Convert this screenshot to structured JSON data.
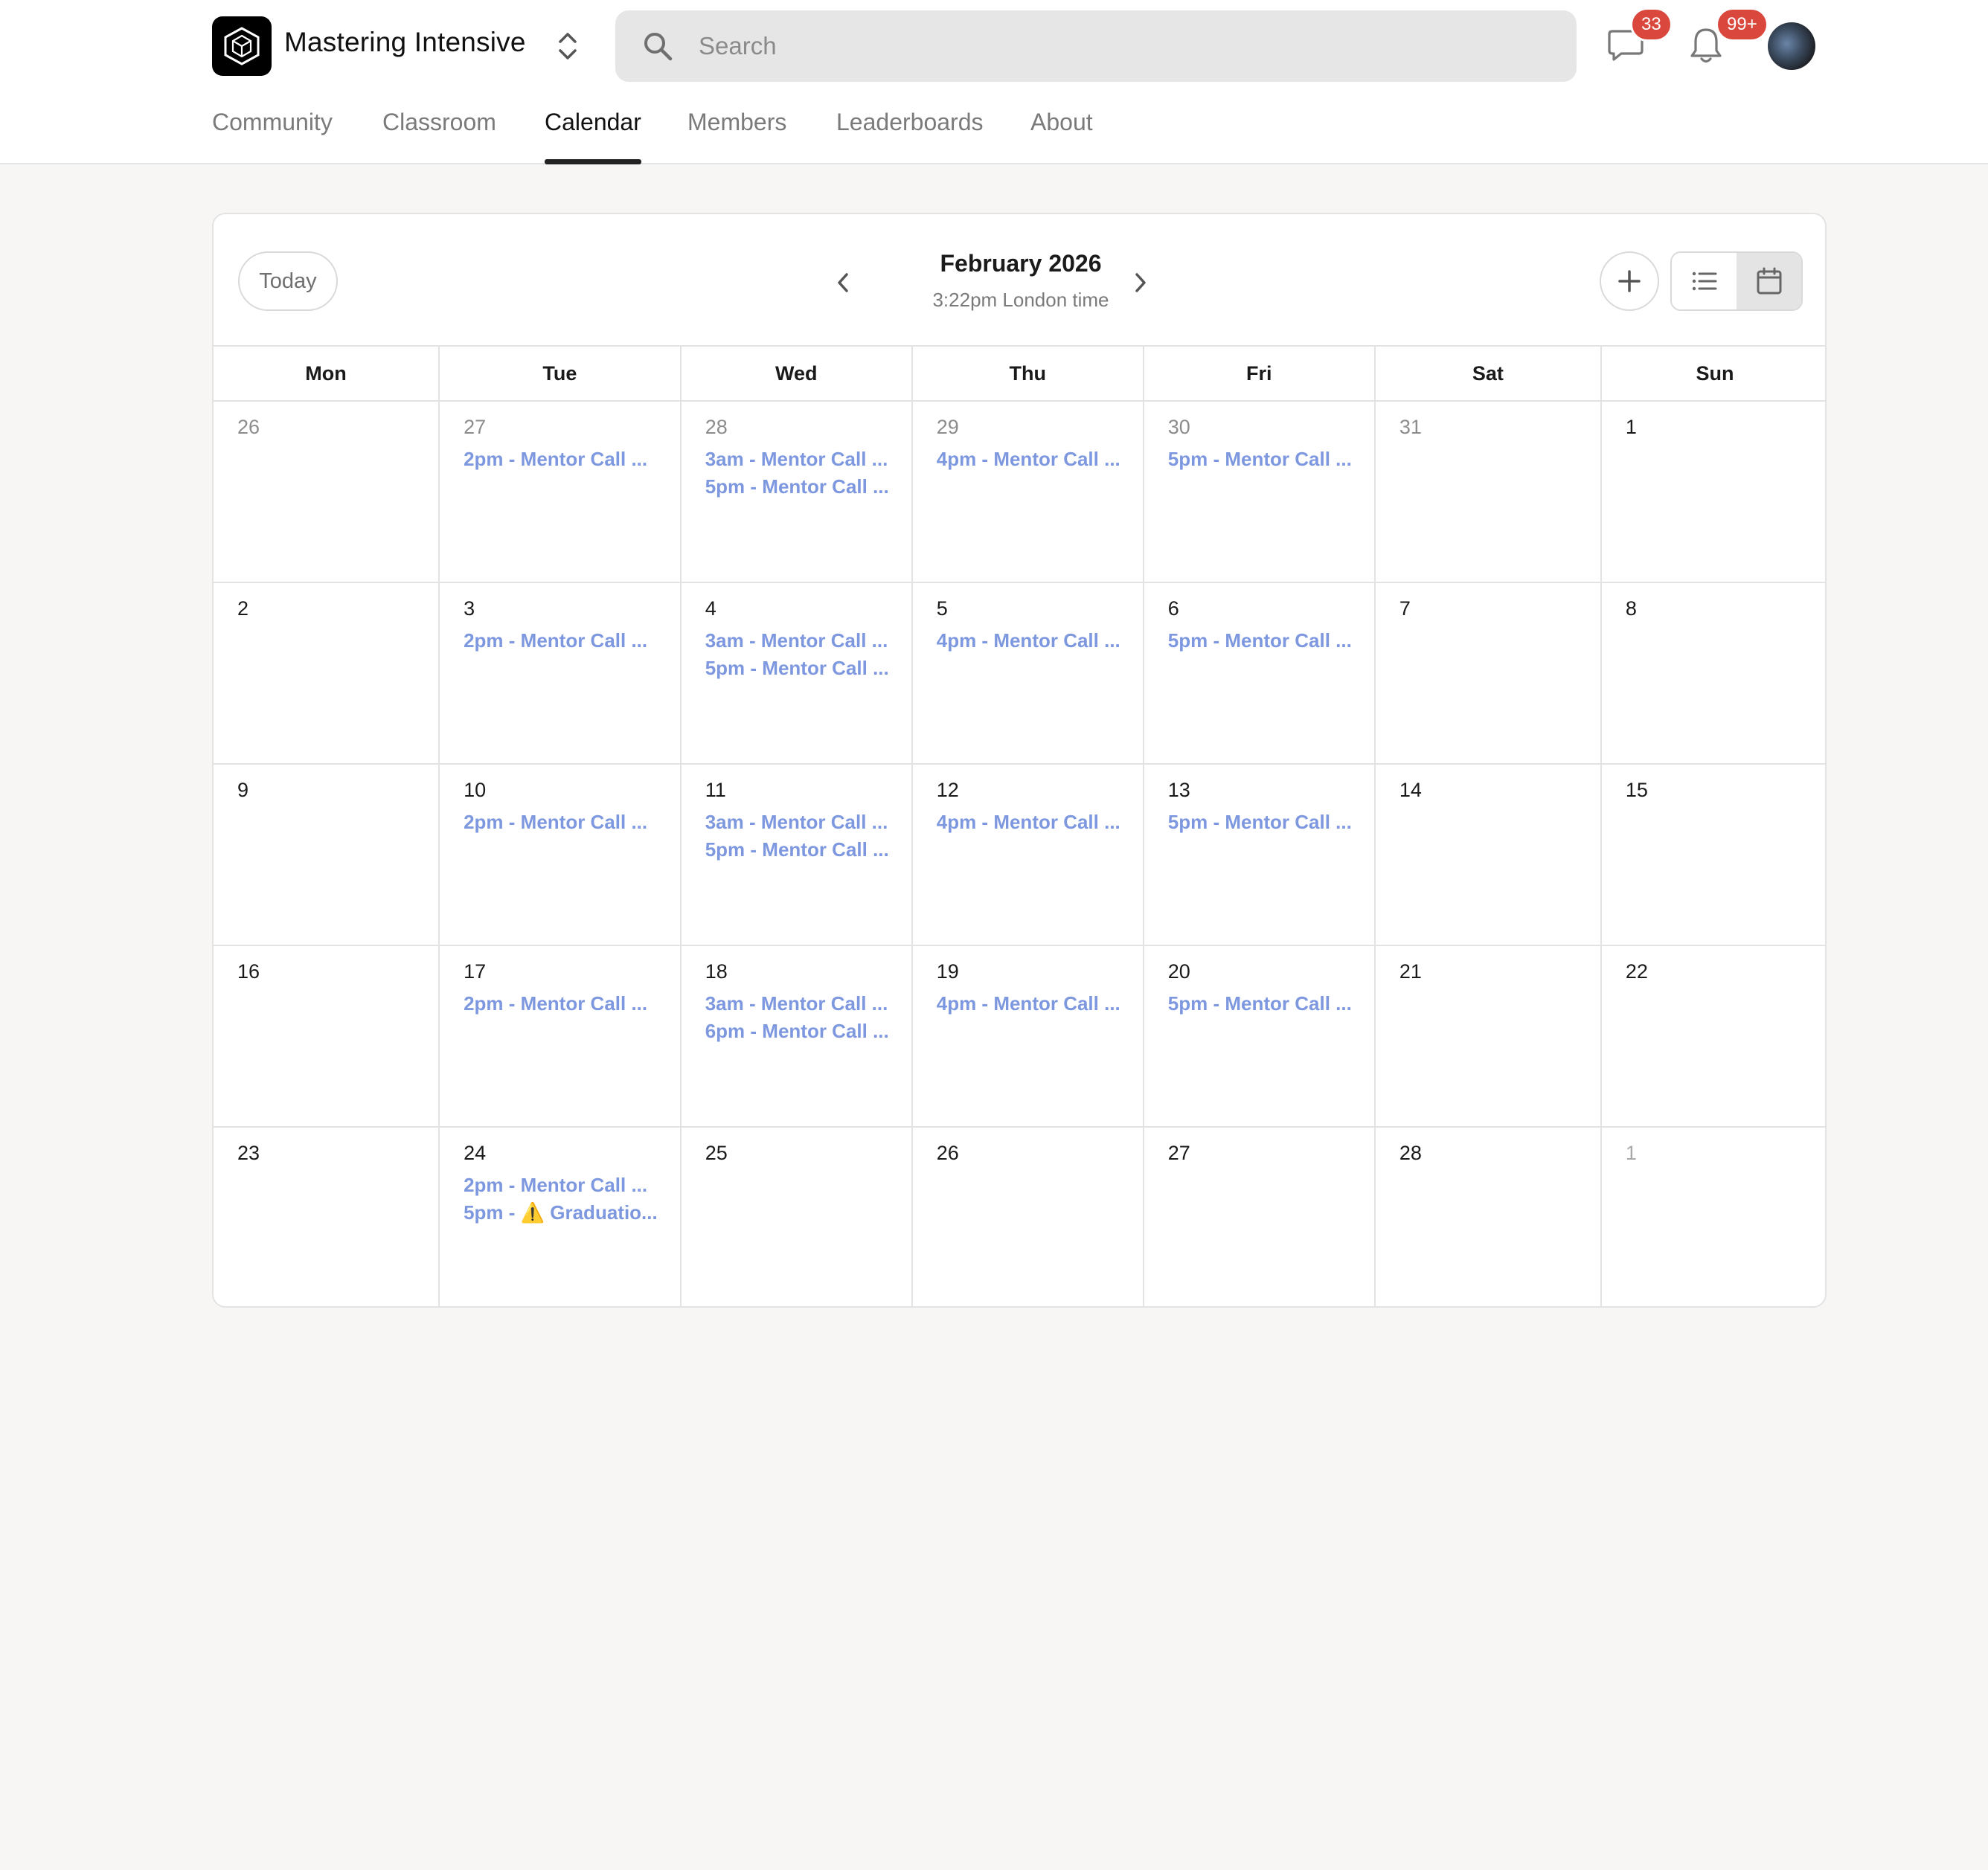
{
  "header": {
    "group_name": "Mastering Intensive",
    "search_placeholder": "Search",
    "chat_badge": "33",
    "notification_badge": "99+",
    "logo_icon": "cube-logo-icon",
    "switcher_icon": "chevron-up-down-icon"
  },
  "nav": {
    "tabs": [
      {
        "label": "Community",
        "active": false
      },
      {
        "label": "Classroom",
        "active": false
      },
      {
        "label": "Calendar",
        "active": true
      },
      {
        "label": "Members",
        "active": false
      },
      {
        "label": "Leaderboards",
        "active": false
      },
      {
        "label": "About",
        "active": false
      }
    ]
  },
  "calendar": {
    "today_label": "Today",
    "month_title": "February 2026",
    "time_subtitle": "3:22pm London time",
    "view_mode": "calendar",
    "weekdays": [
      "Mon",
      "Tue",
      "Wed",
      "Thu",
      "Fri",
      "Sat",
      "Sun"
    ],
    "weeks": [
      [
        {
          "day": "26",
          "muted": true,
          "events": []
        },
        {
          "day": "27",
          "muted": true,
          "events": [
            "2pm - Mentor Call ..."
          ]
        },
        {
          "day": "28",
          "muted": true,
          "events": [
            "3am - Mentor Call ...",
            "5pm - Mentor Call ..."
          ]
        },
        {
          "day": "29",
          "muted": true,
          "events": [
            "4pm - Mentor Call ..."
          ]
        },
        {
          "day": "30",
          "muted": true,
          "events": [
            "5pm - Mentor Call ..."
          ]
        },
        {
          "day": "31",
          "muted": true,
          "events": []
        },
        {
          "day": "1",
          "muted": false,
          "events": []
        }
      ],
      [
        {
          "day": "2",
          "muted": false,
          "events": []
        },
        {
          "day": "3",
          "muted": false,
          "events": [
            "2pm - Mentor Call ..."
          ]
        },
        {
          "day": "4",
          "muted": false,
          "events": [
            "3am - Mentor Call ...",
            "5pm - Mentor Call ..."
          ]
        },
        {
          "day": "5",
          "muted": false,
          "events": [
            "4pm - Mentor Call ..."
          ]
        },
        {
          "day": "6",
          "muted": false,
          "events": [
            "5pm - Mentor Call ..."
          ]
        },
        {
          "day": "7",
          "muted": false,
          "events": []
        },
        {
          "day": "8",
          "muted": false,
          "events": []
        }
      ],
      [
        {
          "day": "9",
          "muted": false,
          "events": []
        },
        {
          "day": "10",
          "muted": false,
          "events": [
            "2pm - Mentor Call ..."
          ]
        },
        {
          "day": "11",
          "muted": false,
          "events": [
            "3am - Mentor Call ...",
            "5pm - Mentor Call ..."
          ]
        },
        {
          "day": "12",
          "muted": false,
          "events": [
            "4pm - Mentor Call ..."
          ]
        },
        {
          "day": "13",
          "muted": false,
          "events": [
            "5pm - Mentor Call ..."
          ]
        },
        {
          "day": "14",
          "muted": false,
          "events": []
        },
        {
          "day": "15",
          "muted": false,
          "events": []
        }
      ],
      [
        {
          "day": "16",
          "muted": false,
          "events": []
        },
        {
          "day": "17",
          "muted": false,
          "events": [
            "2pm - Mentor Call ..."
          ]
        },
        {
          "day": "18",
          "muted": false,
          "events": [
            "3am - Mentor Call ...",
            "6pm - Mentor Call ..."
          ]
        },
        {
          "day": "19",
          "muted": false,
          "events": [
            "4pm - Mentor Call ..."
          ]
        },
        {
          "day": "20",
          "muted": false,
          "events": [
            "5pm - Mentor Call ..."
          ]
        },
        {
          "day": "21",
          "muted": false,
          "events": []
        },
        {
          "day": "22",
          "muted": false,
          "events": []
        }
      ],
      [
        {
          "day": "23",
          "muted": false,
          "events": []
        },
        {
          "day": "24",
          "muted": false,
          "events": [
            "2pm - Mentor Call ...",
            "5pm - ⚠️ Graduatio..."
          ]
        },
        {
          "day": "25",
          "muted": false,
          "events": []
        },
        {
          "day": "26",
          "muted": false,
          "events": []
        },
        {
          "day": "27",
          "muted": false,
          "events": []
        },
        {
          "day": "28",
          "muted": false,
          "events": []
        },
        {
          "day": "1",
          "muted": true,
          "events": []
        }
      ]
    ]
  },
  "colors": {
    "event_text": "#7e98e0",
    "badge": "#d9473d",
    "active_tab_underline": "#222222"
  }
}
